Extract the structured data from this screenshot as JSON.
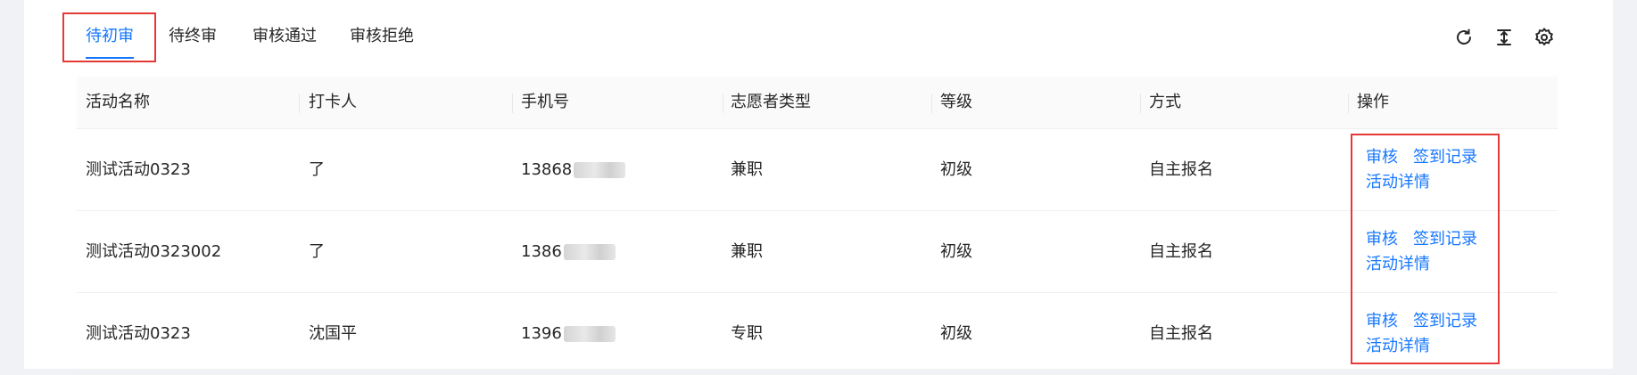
{
  "tabs": [
    {
      "label": "待初审",
      "active": true
    },
    {
      "label": "待终审",
      "active": false
    },
    {
      "label": "审核通过",
      "active": false
    },
    {
      "label": "审核拒绝",
      "active": false
    }
  ],
  "toolbar": {
    "icons": [
      "refresh-icon",
      "column-height-icon",
      "settings-icon"
    ]
  },
  "table": {
    "columns": [
      "活动名称",
      "打卡人",
      "手机号",
      "志愿者类型",
      "等级",
      "方式",
      "操作"
    ],
    "rows": [
      {
        "activity": "测试活动0323",
        "person": "了",
        "phone": "13868",
        "volunteer_type": "兼职",
        "level": "初级",
        "method": "自主报名"
      },
      {
        "activity": "测试活动0323002",
        "person": "了",
        "phone": "1386",
        "volunteer_type": "兼职",
        "level": "初级",
        "method": "自主报名"
      },
      {
        "activity": "测试活动0323",
        "person": "沈国平",
        "phone": "1396",
        "volunteer_type": "专职",
        "level": "初级",
        "method": "自主报名"
      }
    ],
    "actions": {
      "review": "审核",
      "checkin_records": "签到记录",
      "activity_details": "活动详情"
    }
  },
  "colors": {
    "accent": "#1677ff",
    "highlight": "#e53935",
    "header_bg": "#fafafa"
  }
}
